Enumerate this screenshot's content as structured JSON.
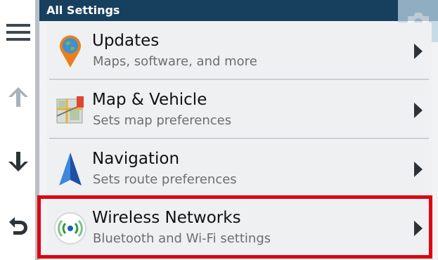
{
  "header": {
    "title": "All Settings"
  },
  "rail": {
    "menu_icon": "hamburger-menu-icon",
    "up_icon": "arrow-up-icon",
    "down_icon": "arrow-down-icon",
    "back_icon": "back-icon"
  },
  "camera": {
    "icon": "camera-icon"
  },
  "items": [
    {
      "title": "Updates",
      "subtitle": "Maps, software, and more",
      "icon": "map-pin-globe-icon"
    },
    {
      "title": "Map & Vehicle",
      "subtitle": "Sets map preferences",
      "icon": "map-vehicle-icon"
    },
    {
      "title": "Navigation",
      "subtitle": "Sets route preferences",
      "icon": "navigation-arrow-icon"
    },
    {
      "title": "Wireless Networks",
      "subtitle": "Bluetooth and Wi-Fi settings",
      "icon": "wireless-icon"
    }
  ],
  "colors": {
    "header_bg": "#173f5e",
    "highlight": "#e0000f",
    "rail_icon": "#3c4750"
  }
}
